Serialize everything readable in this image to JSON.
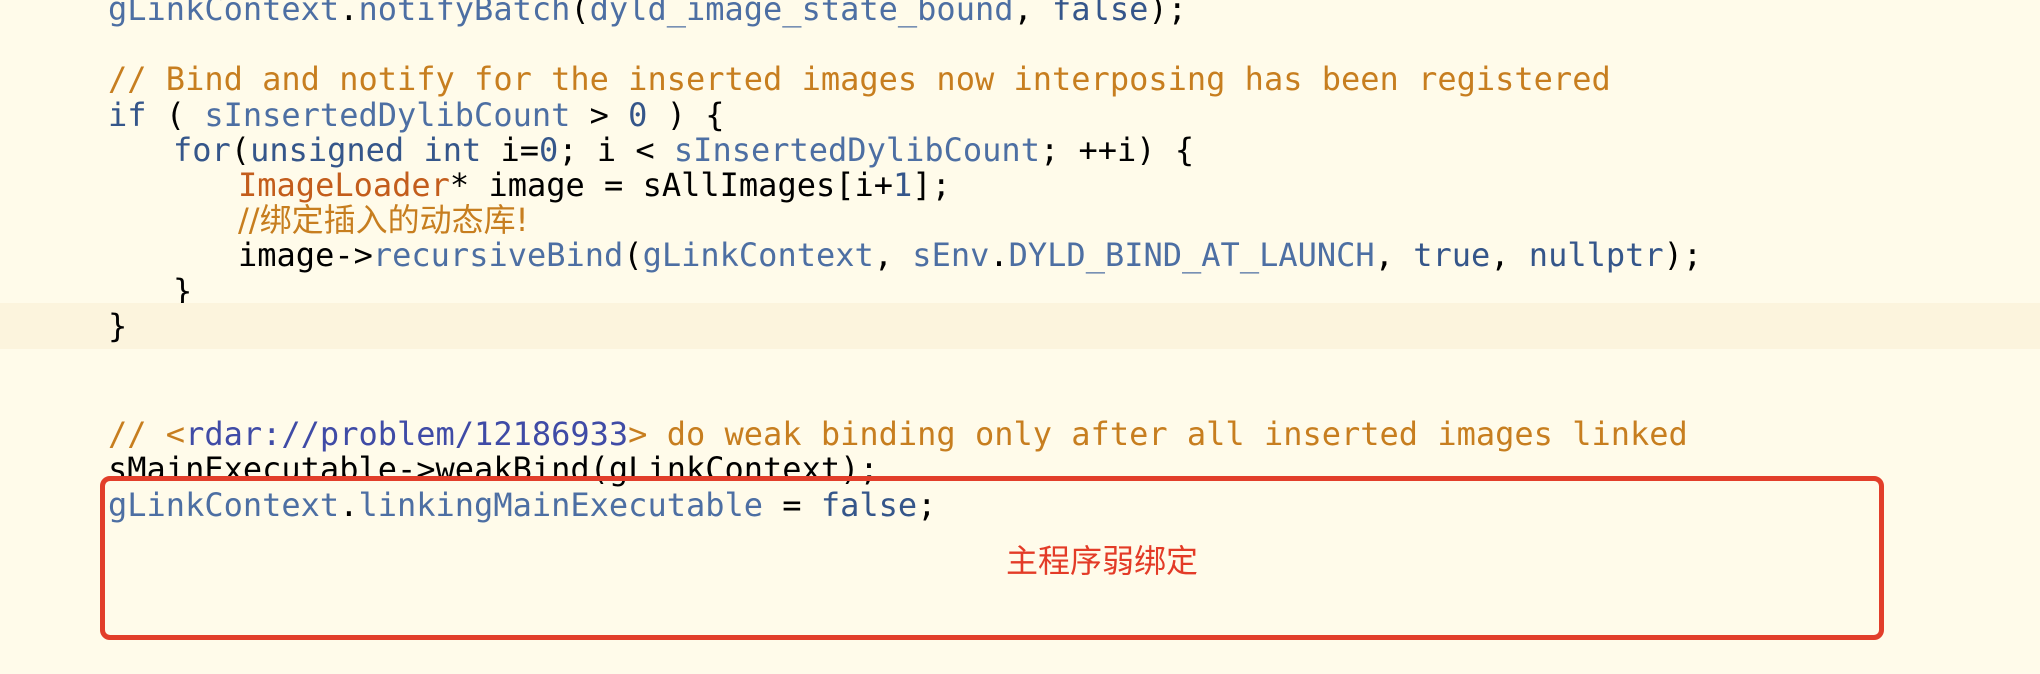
{
  "editor": {
    "lines": [
      {
        "indent": 0,
        "tokens": [
          {
            "t": "gLinkContext",
            "c": "id"
          },
          {
            "t": ".",
            "c": ""
          },
          {
            "t": "notifyBatch",
            "c": "id"
          },
          {
            "t": "(",
            "c": ""
          },
          {
            "t": "dyld_image_state_bound",
            "c": "id"
          },
          {
            "t": ", ",
            "c": ""
          },
          {
            "t": "false",
            "c": "kw"
          },
          {
            "t": ");",
            "c": ""
          }
        ]
      },
      {
        "indent": 0,
        "tokens": []
      },
      {
        "indent": 0,
        "tokens": [
          {
            "t": "// Bind and notify for the inserted images now interposing has been registered",
            "c": "cmt"
          }
        ]
      },
      {
        "indent": 0,
        "tokens": [
          {
            "t": "if",
            "c": "kw"
          },
          {
            "t": " ( ",
            "c": ""
          },
          {
            "t": "sInsertedDylibCount",
            "c": "id"
          },
          {
            "t": " > ",
            "c": ""
          },
          {
            "t": "0",
            "c": "num"
          },
          {
            "t": " ) {",
            "c": ""
          }
        ]
      },
      {
        "indent": 1,
        "tokens": [
          {
            "t": "for",
            "c": "kw"
          },
          {
            "t": "(",
            "c": ""
          },
          {
            "t": "unsigned",
            "c": "kw"
          },
          {
            "t": " ",
            "c": ""
          },
          {
            "t": "int",
            "c": "kw"
          },
          {
            "t": " i=",
            "c": ""
          },
          {
            "t": "0",
            "c": "num"
          },
          {
            "t": "; i < ",
            "c": ""
          },
          {
            "t": "sInsertedDylibCount",
            "c": "id"
          },
          {
            "t": "; ++i) {",
            "c": ""
          }
        ]
      },
      {
        "indent": 2,
        "tokens": [
          {
            "t": "ImageLoader",
            "c": "type"
          },
          {
            "t": "* image = sAllImages[i+",
            "c": ""
          },
          {
            "t": "1",
            "c": "num"
          },
          {
            "t": "];",
            "c": ""
          }
        ]
      },
      {
        "indent": 2,
        "tokens": [
          {
            "t": "//绑定插入的动态库!",
            "c": "cmt cjk"
          }
        ]
      },
      {
        "indent": 2,
        "tokens": [
          {
            "t": "image->",
            "c": ""
          },
          {
            "t": "recursiveBind",
            "c": "id"
          },
          {
            "t": "(",
            "c": ""
          },
          {
            "t": "gLinkContext",
            "c": "id"
          },
          {
            "t": ", ",
            "c": ""
          },
          {
            "t": "sEnv",
            "c": "id"
          },
          {
            "t": ".",
            "c": ""
          },
          {
            "t": "DYLD_BIND_AT_LAUNCH",
            "c": "id"
          },
          {
            "t": ", ",
            "c": ""
          },
          {
            "t": "true",
            "c": "kw"
          },
          {
            "t": ", ",
            "c": ""
          },
          {
            "t": "nullptr",
            "c": "kw"
          },
          {
            "t": ");",
            "c": ""
          }
        ]
      },
      {
        "indent": 1,
        "tokens": [
          {
            "t": "}",
            "c": ""
          }
        ]
      },
      {
        "indent": 0,
        "current": true,
        "tokens": [
          {
            "t": "}",
            "c": ""
          }
        ]
      },
      {
        "indent": 0,
        "tokens": []
      },
      {
        "indent": 0,
        "tokens": [
          {
            "t": "// <",
            "c": "cmt"
          },
          {
            "t": "rdar://problem/12186933",
            "c": "link"
          },
          {
            "t": "> do weak binding only after all inserted images linked",
            "c": "cmt"
          }
        ]
      },
      {
        "indent": 0,
        "tokens": [
          {
            "t": "sMainExecutable->weakBind(gLinkContext);",
            "c": ""
          }
        ]
      },
      {
        "indent": 0,
        "tokens": [
          {
            "t": "gLinkContext",
            "c": "id"
          },
          {
            "t": ".",
            "c": ""
          },
          {
            "t": "linkingMainExecutable",
            "c": "id"
          },
          {
            "t": " = ",
            "c": ""
          },
          {
            "t": "false",
            "c": "kw"
          },
          {
            "t": ";",
            "c": ""
          }
        ]
      }
    ]
  },
  "annotation": {
    "text": "主程序弱绑定",
    "color": "#e33b27"
  },
  "colors": {
    "background": "#fffbea",
    "current_line": "#fcf4dd",
    "keyword": "#35568a",
    "identifier": "#4d6fa3",
    "comment": "#c77e1f",
    "type": "#c35d1c",
    "highlight_box": "#e23e2a"
  }
}
